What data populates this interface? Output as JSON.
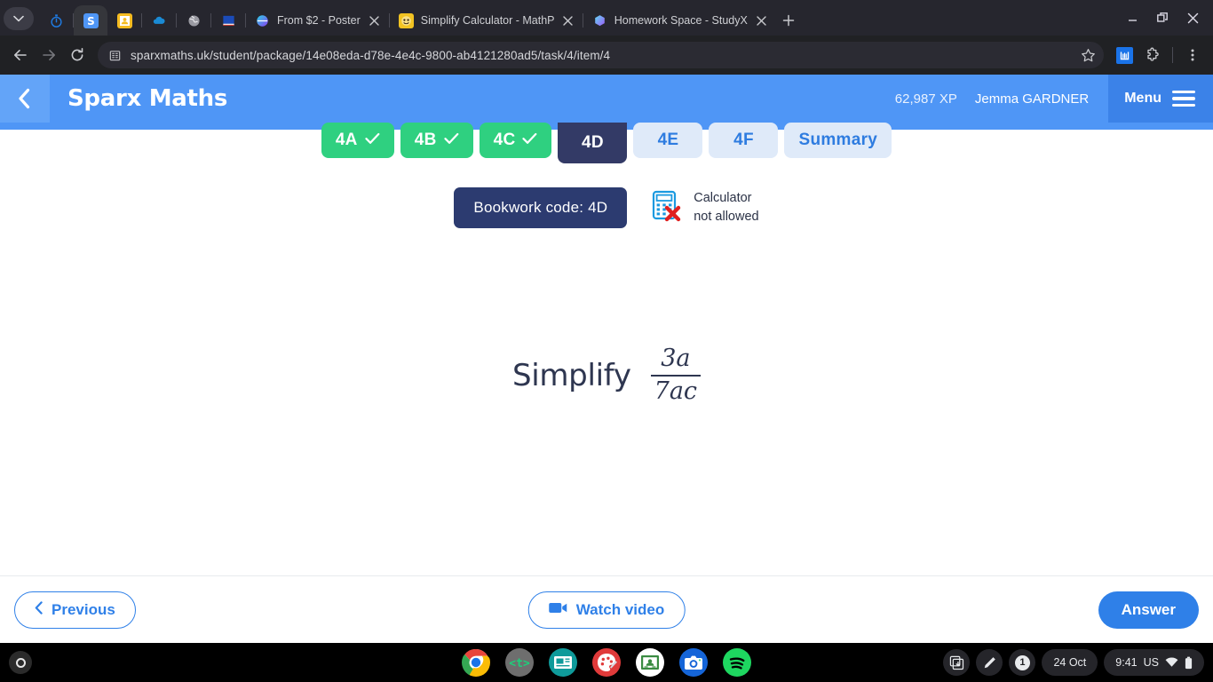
{
  "browser": {
    "tabs": [
      {
        "title": "From $2 - Poster",
        "favicon": "poster-icon",
        "active": false
      },
      {
        "title": "Simplify Calculator - MathPapa",
        "favicon": "mathpapa-icon",
        "active": false
      },
      {
        "title": "Homework Space - StudyX",
        "favicon": "studyx-icon",
        "active": false
      }
    ],
    "pinned_tabs": [
      {
        "name": "stopwatch-icon"
      },
      {
        "name": "sparx-icon",
        "active": true
      },
      {
        "name": "classroom-icon"
      },
      {
        "name": "onedrive-icon"
      },
      {
        "name": "globe-icon"
      },
      {
        "name": "book-icon"
      }
    ],
    "new_tab_label": "+",
    "url": "sparxmaths.uk/student/package/14e08eda-d78e-4e4c-9800-ab4121280ad5/task/4/item/4",
    "toolbar_icons": [
      "back-icon",
      "forward-icon",
      "reload-icon",
      "site-info-icon",
      "bookmark-star-icon",
      "extension-icon",
      "extensions-puzzle-icon",
      "chrome-menu-icon"
    ],
    "window_controls": [
      "minimize-icon",
      "restore-icon",
      "close-icon"
    ]
  },
  "sparx": {
    "back_label": "‹",
    "title": "Sparx Maths",
    "xp": "62,987 XP",
    "user": "Jemma GARDNER",
    "menu_label": "Menu",
    "task_tabs": [
      {
        "label": "4A",
        "state": "done"
      },
      {
        "label": "4B",
        "state": "done"
      },
      {
        "label": "4C",
        "state": "done"
      },
      {
        "label": "4D",
        "state": "current"
      },
      {
        "label": "4E",
        "state": "todo"
      },
      {
        "label": "4F",
        "state": "todo"
      },
      {
        "label": "Summary",
        "state": "todo"
      }
    ],
    "bookwork_code": "Bookwork code: 4D",
    "calculator_line1": "Calculator",
    "calculator_line2": "not allowed",
    "question": {
      "prompt": "Simplify",
      "numerator": "3a",
      "denominator": "7ac"
    },
    "buttons": {
      "previous": "Previous",
      "watch_video": "Watch video",
      "answer": "Answer"
    },
    "colors": {
      "header_blue": "#4f96f6",
      "menu_blue": "#3b82e8",
      "accent_blue": "#2f80e8",
      "done_green": "#2fd080",
      "current_navy": "#333a66",
      "todo_blue_bg": "#dfeaf9",
      "bookwork_navy": "#2c3b70"
    }
  },
  "shelf": {
    "launcher": "launcher-icon",
    "apps": [
      {
        "name": "chrome-icon",
        "running": true
      },
      {
        "name": "typing-club-icon",
        "running": false
      },
      {
        "name": "news-app-icon",
        "running": false
      },
      {
        "name": "paint-palette-icon",
        "running": false
      },
      {
        "name": "google-classroom-icon",
        "running": true
      },
      {
        "name": "camera-icon",
        "running": false
      },
      {
        "name": "spotify-icon",
        "running": false
      }
    ],
    "status": {
      "screen_capture": "screen-capture-icon",
      "stylus": "stylus-icon",
      "notification_count": "1",
      "date": "24 Oct",
      "time": "9:41",
      "keyboard_layout": "US",
      "wifi": "wifi-icon",
      "battery": "battery-icon"
    }
  }
}
